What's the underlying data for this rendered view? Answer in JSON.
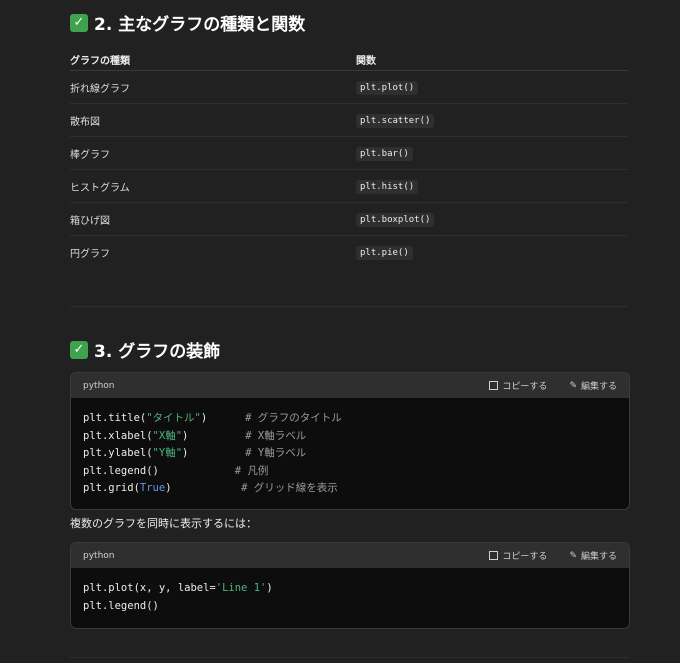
{
  "section2": {
    "check": "✅",
    "title": "2. 主なグラフの種類と関数",
    "table": {
      "headers": [
        "グラフの種類",
        "関数"
      ],
      "rows": [
        [
          "折れ線グラフ",
          "plt.plot()"
        ],
        [
          "散布図",
          "plt.scatter()"
        ],
        [
          "棒グラフ",
          "plt.bar()"
        ],
        [
          "ヒストグラム",
          "plt.hist()"
        ],
        [
          "箱ひげ図",
          "plt.boxplot()"
        ],
        [
          "円グラフ",
          "plt.pie()"
        ]
      ]
    }
  },
  "section3": {
    "check": "✅",
    "title": "3. グラフの装飾",
    "code1": {
      "language": "python",
      "copy_label": "コピーする",
      "edit_label": "編集する",
      "lines": [
        {
          "code": "plt.title(",
          "str": "\"タイトル\"",
          "rest": ")      ",
          "comment": "# グラフのタイトル"
        },
        {
          "code": "plt.xlabel(",
          "str": "\"X軸\"",
          "rest": ")         ",
          "comment": "# X軸ラベル"
        },
        {
          "code": "plt.ylabel(",
          "str": "\"Y軸\"",
          "rest": ")         ",
          "comment": "# Y軸ラベル"
        },
        {
          "code": "plt.legend()            ",
          "str": "",
          "rest": "",
          "comment": "# 凡例"
        },
        {
          "code": "plt.grid(",
          "kw": "True",
          "rest": ")           ",
          "comment": "# グリッド線を表示"
        }
      ]
    },
    "paragraph": "複数のグラフを同時に表示するには：",
    "code2": {
      "language": "python",
      "copy_label": "コピーする",
      "edit_label": "編集する",
      "line1_prefix": "plt.plot(x, y, label=",
      "line1_str": "'Line 1'",
      "line1_suffix": ")",
      "line2": "plt.legend()"
    }
  },
  "icons": {
    "copy": "copy-icon",
    "edit": "edit-icon",
    "check": "check-icon"
  }
}
